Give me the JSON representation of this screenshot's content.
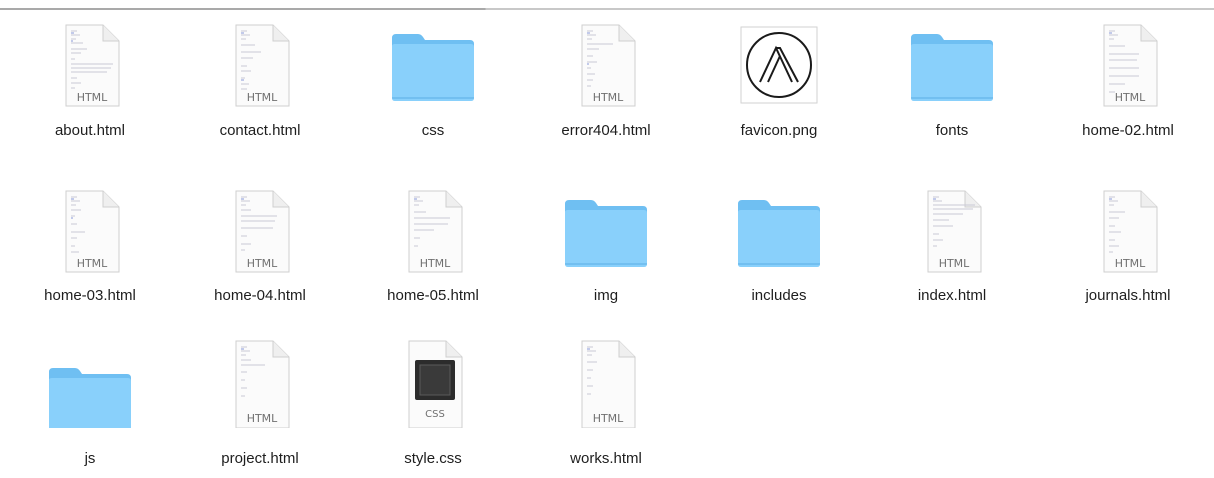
{
  "files": [
    {
      "name": "about.html",
      "kind": "html",
      "badge": "HTML"
    },
    {
      "name": "contact.html",
      "kind": "html",
      "badge": "HTML"
    },
    {
      "name": "css",
      "kind": "folder"
    },
    {
      "name": "error404.html",
      "kind": "html",
      "badge": "HTML"
    },
    {
      "name": "favicon.png",
      "kind": "image"
    },
    {
      "name": "fonts",
      "kind": "folder"
    },
    {
      "name": "home-02.html",
      "kind": "html",
      "badge": "HTML"
    },
    {
      "name": "home-03.html",
      "kind": "html",
      "badge": "HTML"
    },
    {
      "name": "home-04.html",
      "kind": "html",
      "badge": "HTML"
    },
    {
      "name": "home-05.html",
      "kind": "html",
      "badge": "HTML"
    },
    {
      "name": "img",
      "kind": "folder"
    },
    {
      "name": "includes",
      "kind": "folder"
    },
    {
      "name": "index.html",
      "kind": "html",
      "badge": "HTML"
    },
    {
      "name": "journals.html",
      "kind": "html",
      "badge": "HTML"
    },
    {
      "name": "js",
      "kind": "folder"
    },
    {
      "name": "project.html",
      "kind": "html",
      "badge": "HTML"
    },
    {
      "name": "style.css",
      "kind": "css",
      "badge": "CSS"
    },
    {
      "name": "works.html",
      "kind": "html",
      "badge": "HTML"
    }
  ],
  "icons": {
    "html": "html-document-icon",
    "folder": "folder-icon",
    "image": "png-image-icon",
    "css": "css-document-icon"
  },
  "colors": {
    "folder_back": "#6fbff2",
    "folder_front": "#89d0fb",
    "folder_edge": "#5aaee6",
    "label": "#1e1e1e"
  }
}
